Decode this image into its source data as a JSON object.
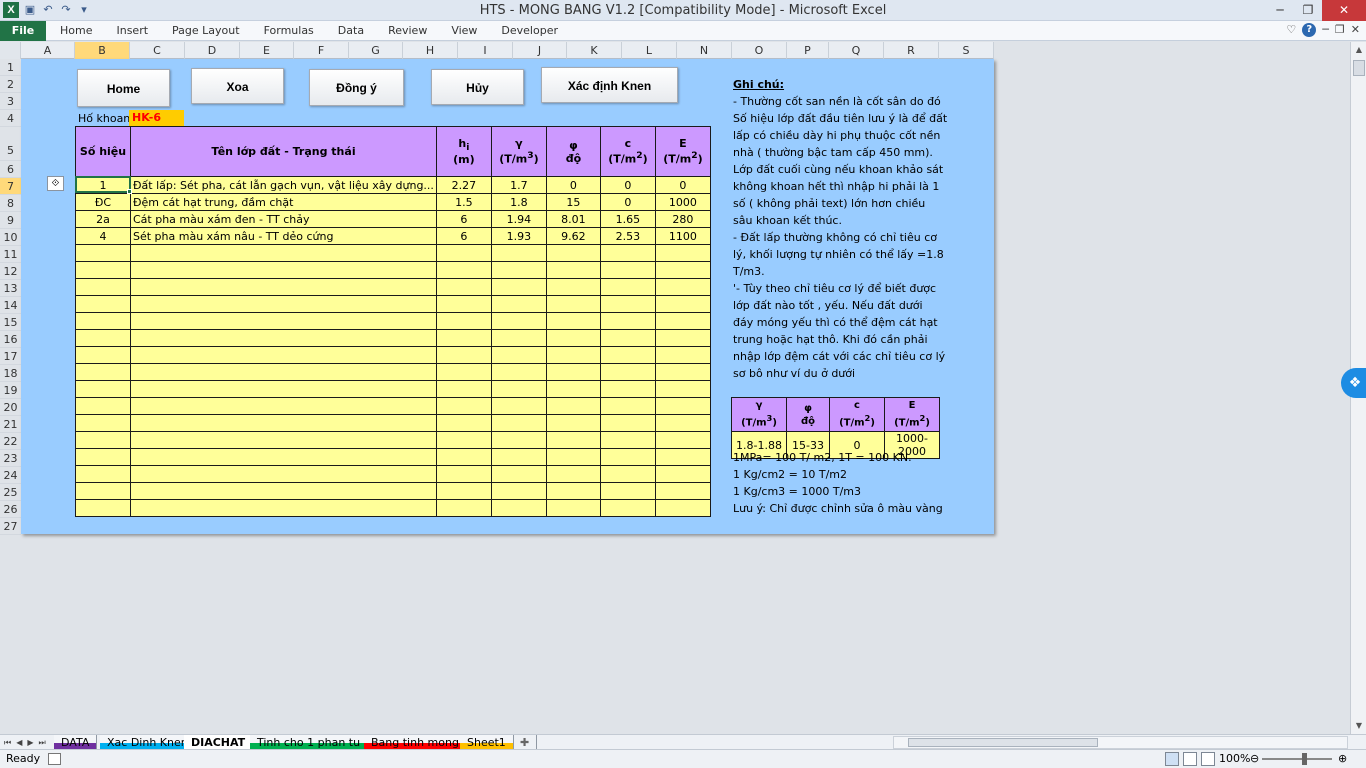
{
  "window": {
    "title": "HTS - MONG BANG V1.2  [Compatibility Mode]  -  Microsoft Excel"
  },
  "ribbon": {
    "file": "File",
    "tabs": [
      "Home",
      "Insert",
      "Page Layout",
      "Formulas",
      "Data",
      "Review",
      "View",
      "Developer"
    ]
  },
  "columns": [
    "A",
    "B",
    "C",
    "D",
    "E",
    "F",
    "G",
    "H",
    "I",
    "J",
    "K",
    "L",
    "N",
    "O",
    "P",
    "Q",
    "R",
    "S"
  ],
  "rows": [
    "1",
    "2",
    "3",
    "4",
    "5",
    "6",
    "7",
    "8",
    "9",
    "10",
    "11",
    "12",
    "13",
    "14",
    "15",
    "16",
    "17",
    "18",
    "19",
    "20",
    "21",
    "22",
    "23",
    "24",
    "25",
    "26",
    "27"
  ],
  "buttons": {
    "home": "Home",
    "xoa": "Xoa",
    "dong_y": "Đồng ý",
    "huy": "Hủy",
    "kn": "Xác định Knen"
  },
  "ho_khoan": {
    "label": "Hố khoan:",
    "value": "HK-6"
  },
  "table": {
    "headers": [
      "Số hiệu",
      "Tên lớp đất - Trạng thái",
      "h",
      "(m)",
      "γ",
      "(T/m",
      "φ",
      "độ",
      "c",
      "(T/m",
      "E",
      "(T/m"
    ],
    "rows": [
      [
        "1",
        "Đất lấp: Sét pha, cát lẫn gạch vụn, vật liệu xây dựng...",
        "2.27",
        "1.7",
        "0",
        "0",
        "0"
      ],
      [
        "ĐC",
        "Đệm cát hạt trung, đầm chặt",
        "1.5",
        "1.8",
        "15",
        "0",
        "1000"
      ],
      [
        "2a",
        " Cát pha màu xám đen - TT chảy",
        "6",
        "1.94",
        "8.01",
        "1.65",
        "280"
      ],
      [
        "4",
        "Sét pha màu xám nâu - TT dẻo cứng",
        "6",
        "1.93",
        "9.62",
        "2.53",
        "1100"
      ]
    ]
  },
  "notes": {
    "title": "Ghi chú:",
    "lines": [
      "- Thường cốt san nền là cốt sân do đó",
      "Số hiệu lớp đất đầu tiên lưu ý là để đất",
      "lấp có chiều dày hi phụ thuộc cốt nền",
      "nhà ( thường bậc tam cấp 450 mm).",
      "Lớp đất cuối cùng nếu khoan khảo sát",
      "không khoan hết thì nhập hi phải là 1",
      "số ( không phải text) lớn hơn chiều",
      "sâu khoan kết thúc.",
      "-  Đất lấp thường không có chỉ tiêu cơ",
      "lý, khối lượng tự nhiên có thể lấy =1.8",
      "T/m3.",
      "'- Tùy theo chỉ tiêu cơ lý để biết được",
      "lớp đất nào tốt , yếu. Nếu đất dưới",
      "đáy móng yếu thì có thể đệm cát hạt",
      "trung hoặc hạt thô. Khi đó cần phải",
      "nhập lớp đệm cát với các chỉ tiêu cơ lý",
      "sơ bô như ví du ở dưới"
    ]
  },
  "small_table": {
    "headers": [
      "γ",
      "(T/m",
      "φ",
      "độ",
      "c",
      "(T/m",
      "E",
      "(T/m"
    ],
    "values": [
      "1.8-1.88",
      "15-33",
      "0",
      "1000-2000"
    ]
  },
  "after_notes": [
    "1MPa= 100 T/ m2,  1T = 100 KN.",
    "1 Kg/cm2 = 10 T/m2",
    "1 Kg/cm3 = 1000 T/m3",
    "Lưu ý: Chỉ được chỉnh sửa ô màu vàng"
  ],
  "sheets": [
    "DATA",
    "Xac Dinh Knen",
    "DIACHAT",
    "Tinh cho 1 phan tu",
    "Bang tinh mong",
    "Sheet1"
  ],
  "sheet_colors": [
    "#7030a0",
    "#00b0f0",
    "#ffffff",
    "#00b050",
    "#ff0000",
    "#ffc000"
  ],
  "status": {
    "ready": "Ready",
    "zoom": "100%"
  }
}
